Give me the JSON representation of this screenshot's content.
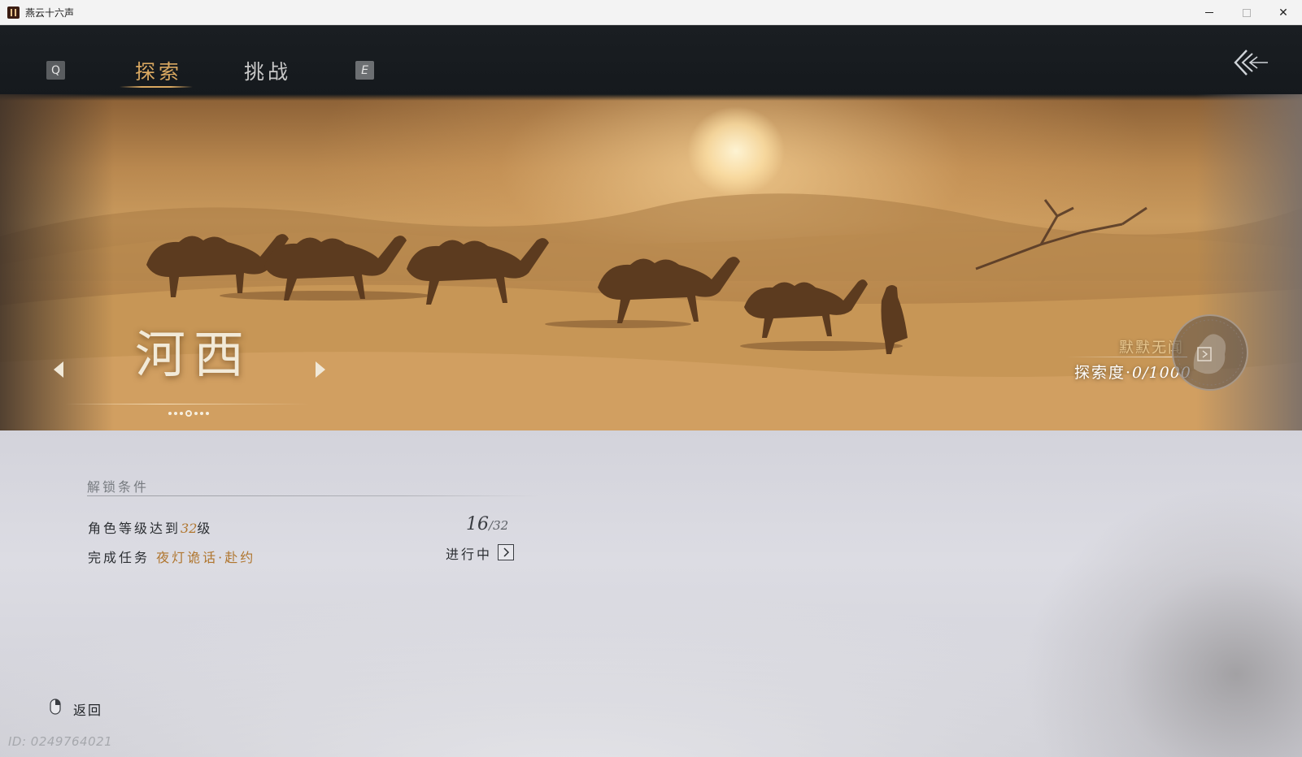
{
  "window": {
    "title": "燕云十六声",
    "minimize_glyph": "—",
    "close_glyph": "✕"
  },
  "topbar": {
    "key_prev": "Q",
    "key_next": "E",
    "tabs": [
      {
        "label": "探索",
        "active": true
      },
      {
        "label": "挑战",
        "active": false
      }
    ],
    "back_icon": "triple-chevron-left-icon"
  },
  "banner": {
    "region_name": "河西",
    "page_count": 7,
    "active_page": 3,
    "fame_label": "默默无闻",
    "explore_label": "探索度·",
    "explore_value": "0/1000"
  },
  "unlock": {
    "title": "解锁条件",
    "conditions": [
      {
        "text_before": "角色等级达到",
        "highlight": "32",
        "text_after": "级",
        "current": "16",
        "separator": "/",
        "required": "32"
      },
      {
        "text_before": "完成任务",
        "highlight": "夜灯诡话·赴约",
        "status": "进行中"
      }
    ]
  },
  "footer": {
    "back_label": "返回",
    "uid": "ID: 0249764021"
  },
  "colors": {
    "gold_accent": "#d9a861",
    "dark_bar": "#15191d",
    "highlight_text": "#b0762f"
  }
}
